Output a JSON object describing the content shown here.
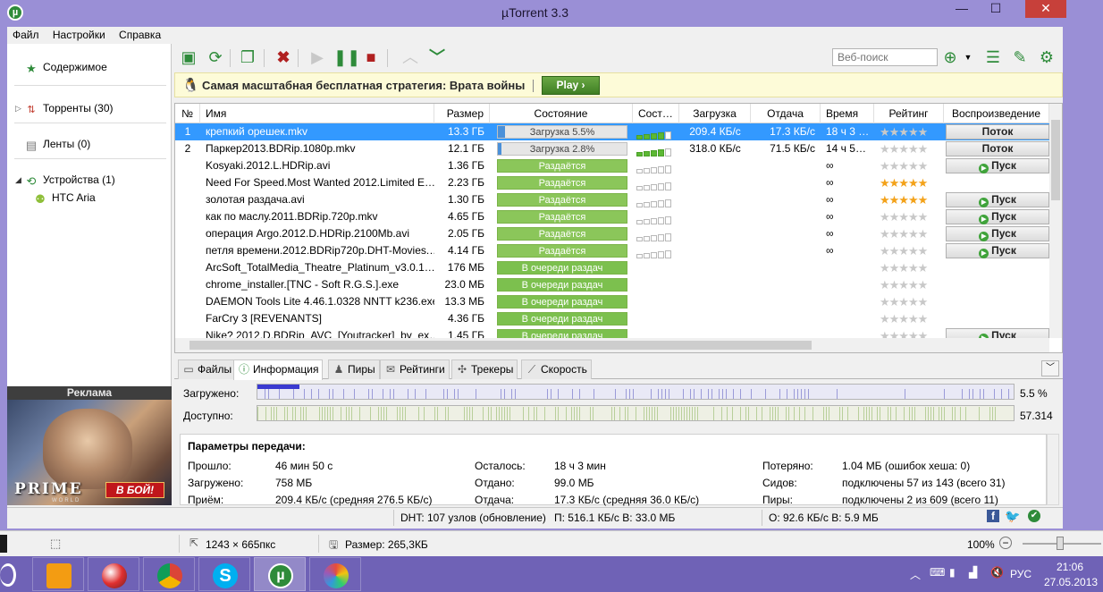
{
  "window": {
    "title": "µTorrent 3.3",
    "close_label": "✕",
    "min_label": "—",
    "max_label": "☐"
  },
  "menu": [
    "Файл",
    "Настройки",
    "Справка"
  ],
  "sidebar": {
    "items": [
      {
        "label": "Содержимое"
      },
      {
        "label": "Торренты (30)"
      },
      {
        "label": "Ленты (0)"
      },
      {
        "label": "Устройства (1)"
      },
      {
        "label": "HTC Aria"
      }
    ],
    "ad_title": "Реклама",
    "ad_logo": "PRIME",
    "ad_logo_sub": "WORLD",
    "ad_cta": "В БОЙ!"
  },
  "toolbar": {
    "search_placeholder": "Веб-поиск"
  },
  "promo": {
    "text": "Самая масштабная бесплатная стратегия: Врата войны",
    "play": "Play ›"
  },
  "table": {
    "columns": [
      "№",
      "Имя",
      "Размер",
      "Состояние",
      "Сост…",
      "Загрузка",
      "Отдача",
      "Время",
      "Рейтинг",
      "Воспроизведение"
    ],
    "rows": [
      {
        "num": "1",
        "name": "крепкий орешек.mkv",
        "size": "13.3 ГБ",
        "state": "Загрузка 5.5%",
        "kind": "dl",
        "progress": 0.055,
        "health": 4,
        "down": "209.4 КБ/с",
        "up": "17.3 КБ/с",
        "eta": "18 ч 3 …",
        "stars": 0,
        "play": "Поток",
        "selected": true
      },
      {
        "num": "2",
        "name": "Паркер2013.BDRip.1080p.mkv",
        "size": "12.1 ГБ",
        "state": "Загрузка 2.8%",
        "kind": "dl",
        "progress": 0.028,
        "health": 4,
        "down": "318.0 КБ/с",
        "up": "71.5 КБ/с",
        "eta": "14 ч 5…",
        "stars": 0,
        "play": "Поток"
      },
      {
        "num": "",
        "name": "Kosyaki.2012.L.HDRip.avi",
        "size": "1.36 ГБ",
        "state": "Раздаётся",
        "kind": "seed",
        "health": 0,
        "down": "",
        "up": "",
        "eta": "∞",
        "stars": 0,
        "play": "Пуск"
      },
      {
        "num": "",
        "name": "Need For Speed.Most Wanted 2012.Limited E…",
        "size": "2.23 ГБ",
        "state": "Раздаётся",
        "kind": "seed",
        "health": 0,
        "down": "",
        "up": "",
        "eta": "∞",
        "stars": 5,
        "play": ""
      },
      {
        "num": "",
        "name": "золотая раздача.avi",
        "size": "1.30 ГБ",
        "state": "Раздаётся",
        "kind": "seed",
        "health": 0,
        "down": "",
        "up": "",
        "eta": "∞",
        "stars": 5,
        "play": "Пуск"
      },
      {
        "num": "",
        "name": "как по маслу.2011.BDRip.720p.mkv",
        "size": "4.65 ГБ",
        "state": "Раздаётся",
        "kind": "seed",
        "health": 0,
        "down": "",
        "up": "",
        "eta": "∞",
        "stars": 0,
        "play": "Пуск"
      },
      {
        "num": "",
        "name": "операция Argo.2012.D.HDRip.2100Mb.avi",
        "size": "2.05 ГБ",
        "state": "Раздаётся",
        "kind": "seed",
        "health": 0,
        "down": "",
        "up": "",
        "eta": "∞",
        "stars": 0,
        "play": "Пуск"
      },
      {
        "num": "",
        "name": "петля времени.2012.BDRip720p.DHT-Movies.…",
        "size": "4.14 ГБ",
        "state": "Раздаётся",
        "kind": "seed",
        "health": 0,
        "down": "",
        "up": "",
        "eta": "∞",
        "stars": 0,
        "play": "Пуск"
      },
      {
        "num": "",
        "name": "ArcSoft_TotalMedia_Theatre_Platinum_v3.0.1…",
        "size": "176 МБ",
        "state": "В очереди раздач",
        "kind": "q",
        "health": 0,
        "down": "",
        "up": "",
        "eta": "",
        "stars": 0,
        "play": ""
      },
      {
        "num": "",
        "name": "chrome_installer.[TNC - Soft R.G.S.].exe",
        "size": "23.0 МБ",
        "state": "В очереди раздач",
        "kind": "q",
        "health": 0,
        "down": "",
        "up": "",
        "eta": "",
        "stars": 0,
        "play": ""
      },
      {
        "num": "",
        "name": "DAEMON Tools Lite 4.46.1.0328 NNTT k236.exe",
        "size": "13.3 МБ",
        "state": "В очереди раздач",
        "kind": "q",
        "health": 0,
        "down": "",
        "up": "",
        "eta": "",
        "stars": 0,
        "play": ""
      },
      {
        "num": "",
        "name": "FarCry 3 [REVENANTS]",
        "size": "4.36 ГБ",
        "state": "В очереди раздач",
        "kind": "q",
        "health": 0,
        "down": "",
        "up": "",
        "eta": "",
        "stars": 0,
        "play": ""
      },
      {
        "num": "",
        "name": "Nike? 2012.D.BDRip_AVC_[Youtracker]_by_ex…",
        "size": "1.45 ГБ",
        "state": "В очереди раздач",
        "kind": "q",
        "health": 0,
        "down": "",
        "up": "",
        "eta": "",
        "stars": 0,
        "play": "Пуск"
      }
    ]
  },
  "tabs": [
    "Файлы",
    "Информация",
    "Пиры",
    "Рейтинги",
    "Трекеры",
    "Скорость"
  ],
  "info": {
    "downloaded_label": "Загружено:",
    "downloaded_pct": "5.5 %",
    "downloaded_fraction": 0.055,
    "available_label": "Доступно:",
    "available_value": "57.314",
    "params_title": "Параметры передачи:",
    "fields": [
      {
        "k": "Прошло:",
        "v": "46 мин 50 с"
      },
      {
        "k": "Загружено:",
        "v": "758 МБ"
      },
      {
        "k": "Приём:",
        "v": "209.4 КБ/с (средняя 276.5 КБ/с)"
      },
      {
        "k": "Осталось:",
        "v": "18 ч 3 мин"
      },
      {
        "k": "Отдано:",
        "v": "99.0 МБ"
      },
      {
        "k": "Отдача:",
        "v": "17.3 КБ/с (средняя 36.0 КБ/с)"
      },
      {
        "k": "Потеряно:",
        "v": "1.04 МБ (ошибок хеша: 0)"
      },
      {
        "k": "Сидов:",
        "v": "подключены 57 из 143 (всего 31)"
      },
      {
        "k": "Пиры:",
        "v": "подключены 2 из 609 (всего 11)"
      }
    ]
  },
  "statusbar": {
    "dht": "DHT: 107 узлов  (обновление)",
    "down": "П: 516.1 КБ/с В: 33.0 МБ",
    "up": "О: 92.6 КБ/с В: 5.9 МБ"
  },
  "host": {
    "dims": "1243 × 665пкс",
    "size": "Размер: 265,3КБ",
    "zoom": "100%"
  },
  "tray": {
    "lang": "РУС",
    "time": "21:06",
    "date": "27.05.2013"
  },
  "colors": {
    "accent": "#3399ff",
    "seed": "#8bc65a",
    "queue": "#7cc04e",
    "window": "#9a8fd6",
    "taskbar": "#6f62b6"
  }
}
